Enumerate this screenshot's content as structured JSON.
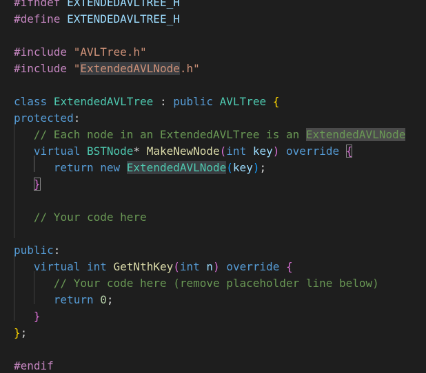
{
  "editor": {
    "lines": [
      {
        "t": [
          {
            "c": "pp",
            "s": "#ifndef"
          },
          {
            "c": "pl",
            "s": " "
          },
          {
            "c": "var",
            "s": "EXTENDEDAVLTREE_H"
          }
        ]
      },
      {
        "t": [
          {
            "c": "pp",
            "s": "#define"
          },
          {
            "c": "pl",
            "s": " "
          },
          {
            "c": "var",
            "s": "EXTENDEDAVLTREE_H"
          }
        ]
      },
      {
        "t": []
      },
      {
        "t": [
          {
            "c": "pp",
            "s": "#include"
          },
          {
            "c": "pl",
            "s": " "
          },
          {
            "c": "str",
            "s": "\"AVLTree.h\""
          }
        ]
      },
      {
        "t": [
          {
            "c": "pp",
            "s": "#include"
          },
          {
            "c": "pl",
            "s": " "
          },
          {
            "c": "str",
            "s": "\""
          },
          {
            "c": "str hl",
            "s": "ExtendedAVLNode"
          },
          {
            "c": "str",
            "s": ".h\""
          }
        ]
      },
      {
        "t": []
      },
      {
        "t": [
          {
            "c": "kw",
            "s": "class"
          },
          {
            "c": "pl",
            "s": " "
          },
          {
            "c": "ty",
            "s": "ExtendedAVLTree"
          },
          {
            "c": "pl",
            "s": " : "
          },
          {
            "c": "kw",
            "s": "public"
          },
          {
            "c": "pl",
            "s": " "
          },
          {
            "c": "ty",
            "s": "AVLTree"
          },
          {
            "c": "pl",
            "s": " "
          },
          {
            "c": "br1",
            "s": "{"
          }
        ]
      },
      {
        "t": [
          {
            "c": "kw",
            "s": "protected"
          },
          {
            "c": "pl",
            "s": ":"
          }
        ]
      },
      {
        "t": [
          {
            "c": "pl",
            "s": "   "
          },
          {
            "c": "cm",
            "s": "// Each node in an ExtendedAVLTree is an "
          },
          {
            "c": "cm hl2",
            "s": "ExtendedAVLNode"
          }
        ]
      },
      {
        "t": [
          {
            "c": "pl",
            "s": "   "
          },
          {
            "c": "kw",
            "s": "virtual"
          },
          {
            "c": "pl",
            "s": " "
          },
          {
            "c": "ty",
            "s": "BSTNode"
          },
          {
            "c": "pl",
            "s": "* "
          },
          {
            "c": "fn",
            "s": "MakeNewNode"
          },
          {
            "c": "br2",
            "s": "("
          },
          {
            "c": "kw",
            "s": "int"
          },
          {
            "c": "pl",
            "s": " "
          },
          {
            "c": "var",
            "s": "key"
          },
          {
            "c": "br2",
            "s": ")"
          },
          {
            "c": "pl",
            "s": " "
          },
          {
            "c": "kw",
            "s": "override"
          },
          {
            "c": "pl",
            "s": " "
          },
          {
            "c": "br2 bm",
            "s": "{"
          }
        ]
      },
      {
        "t": [
          {
            "c": "pl",
            "s": "      "
          },
          {
            "c": "kw",
            "s": "return"
          },
          {
            "c": "pl",
            "s": " "
          },
          {
            "c": "kw",
            "s": "new"
          },
          {
            "c": "pl",
            "s": " "
          },
          {
            "c": "ty hl",
            "s": "ExtendedAVLNode"
          },
          {
            "c": "br3",
            "s": "("
          },
          {
            "c": "var",
            "s": "key"
          },
          {
            "c": "br3",
            "s": ")"
          },
          {
            "c": "pl",
            "s": ";"
          }
        ]
      },
      {
        "t": [
          {
            "c": "pl",
            "s": "   "
          },
          {
            "c": "br2 bm",
            "s": "}"
          }
        ]
      },
      {
        "t": []
      },
      {
        "t": [
          {
            "c": "pl",
            "s": "   "
          },
          {
            "c": "cm",
            "s": "// Your code here"
          }
        ]
      },
      {
        "t": []
      },
      {
        "t": [
          {
            "c": "kw",
            "s": "public"
          },
          {
            "c": "pl",
            "s": ":"
          }
        ]
      },
      {
        "t": [
          {
            "c": "pl",
            "s": "   "
          },
          {
            "c": "kw",
            "s": "virtual"
          },
          {
            "c": "pl",
            "s": " "
          },
          {
            "c": "kw",
            "s": "int"
          },
          {
            "c": "pl",
            "s": " "
          },
          {
            "c": "fn",
            "s": "GetNthKey"
          },
          {
            "c": "br2",
            "s": "("
          },
          {
            "c": "kw",
            "s": "int"
          },
          {
            "c": "pl",
            "s": " "
          },
          {
            "c": "var",
            "s": "n"
          },
          {
            "c": "br2",
            "s": ")"
          },
          {
            "c": "pl",
            "s": " "
          },
          {
            "c": "kw",
            "s": "override"
          },
          {
            "c": "pl",
            "s": " "
          },
          {
            "c": "br2",
            "s": "{"
          }
        ]
      },
      {
        "t": [
          {
            "c": "pl",
            "s": "      "
          },
          {
            "c": "cm",
            "s": "// Your code here (remove placeholder line below)"
          }
        ]
      },
      {
        "t": [
          {
            "c": "pl",
            "s": "      "
          },
          {
            "c": "kw",
            "s": "return"
          },
          {
            "c": "pl",
            "s": " "
          },
          {
            "c": "num",
            "s": "0"
          },
          {
            "c": "pl",
            "s": ";"
          }
        ]
      },
      {
        "t": [
          {
            "c": "pl",
            "s": "   "
          },
          {
            "c": "br2",
            "s": "}"
          }
        ]
      },
      {
        "t": [
          {
            "c": "br1",
            "s": "}"
          },
          {
            "c": "pl",
            "s": ";"
          }
        ]
      },
      {
        "t": []
      },
      {
        "t": [
          {
            "c": "pp",
            "s": "#endif"
          }
        ]
      }
    ]
  }
}
